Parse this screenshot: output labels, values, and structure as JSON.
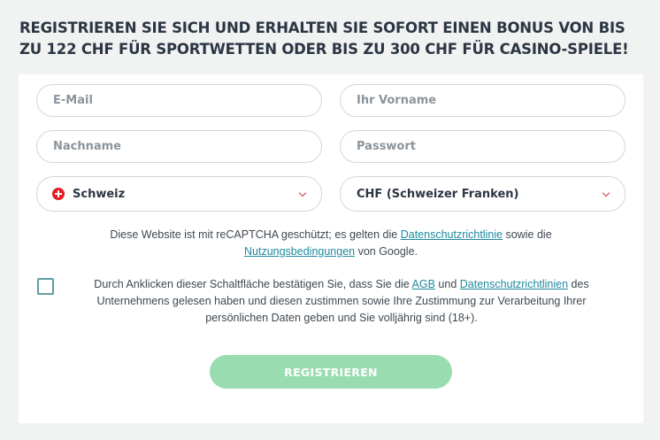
{
  "headline": "REGISTRIEREN SIE SICH UND ERHALTEN SIE SOFORT EINEN BONUS VON BIS ZU 122 CHF FÜR SPORTWETTEN ODER BIS ZU 300 CHF FÜR CASINO-SPIELE!",
  "form": {
    "email_placeholder": "E-Mail",
    "firstname_placeholder": "Ihr Vorname",
    "lastname_placeholder": "Nachname",
    "password_placeholder": "Passwort",
    "country_value": "Schweiz",
    "country_flag_icon": "swiss-flag-icon",
    "currency_value": "CHF (Schweizer Franken)",
    "dropdown_icon": "chevron-down-icon",
    "accent_color": "#d8383c"
  },
  "recaptcha": {
    "text_before": "Diese Website ist mit reCAPTCHA geschützt; es gelten die ",
    "privacy_link": "Datenschutzrichtlinie",
    "text_middle": " sowie die ",
    "terms_link": "Nutzungsbedingungen",
    "text_after": " von Google."
  },
  "consent": {
    "checked": false,
    "text_before": "Durch Anklicken dieser Schaltfläche bestätigen Sie, dass Sie die ",
    "agb_link": "AGB",
    "text_and": " und ",
    "privacy_link": "Datenschutzrichtlinien",
    "text_after": " des Unternehmens gelesen haben und diesen zustimmen sowie Ihre Zustimmung zur Verarbeitung Ihrer persönlichen Daten geben und Sie volljährig sind (18+)."
  },
  "register_button": {
    "label": "REGISTRIEREN",
    "color": "#98dcb0"
  },
  "link_color": "#1f8a9e"
}
